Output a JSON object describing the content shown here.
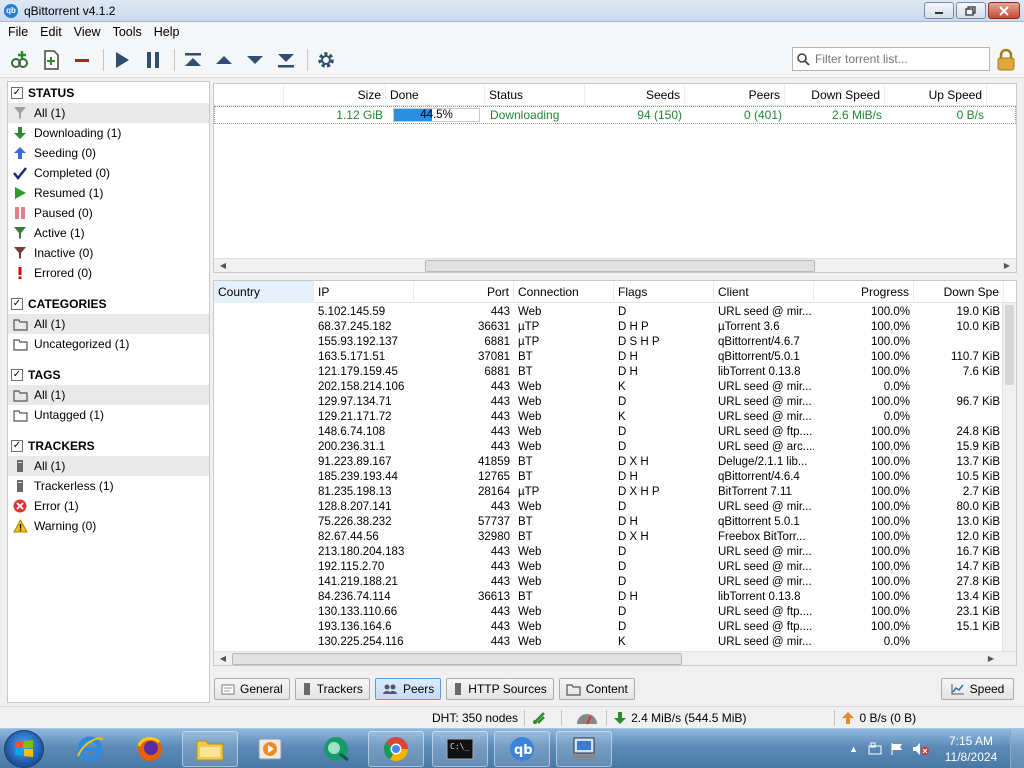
{
  "window": {
    "title": "qBittorrent v4.1.2",
    "app_icon": "qb"
  },
  "menu": [
    "File",
    "Edit",
    "View",
    "Tools",
    "Help"
  ],
  "toolbar": {
    "filter_placeholder": "Filter torrent list..."
  },
  "sidebar": {
    "status": {
      "title": "STATUS",
      "items": [
        {
          "label": "All (1)",
          "icon": "filter-icon",
          "color": "#a0a0a0"
        },
        {
          "label": "Downloading (1)",
          "icon": "arrow-down-icon",
          "color": "#2e8b2e"
        },
        {
          "label": "Seeding (0)",
          "icon": "arrow-up-icon",
          "color": "#3b6fd6"
        },
        {
          "label": "Completed (0)",
          "icon": "checkmark-icon",
          "color": "#1d2b7a"
        },
        {
          "label": "Resumed (1)",
          "icon": "play-icon",
          "color": "#2e9b2e"
        },
        {
          "label": "Paused (0)",
          "icon": "pause-icon",
          "color": "#e08080"
        },
        {
          "label": "Active (1)",
          "icon": "filter-icon",
          "color": "#3a7a3a"
        },
        {
          "label": "Inactive (0)",
          "icon": "filter-icon",
          "color": "#7a3a3a"
        },
        {
          "label": "Errored (0)",
          "icon": "exclamation-icon",
          "color": "#e00000"
        }
      ]
    },
    "categories": {
      "title": "CATEGORIES",
      "items": [
        "All (1)",
        "Uncategorized (1)"
      ]
    },
    "tags": {
      "title": "TAGS",
      "items": [
        "All (1)",
        "Untagged (1)"
      ]
    },
    "trackers": {
      "title": "TRACKERS",
      "items": [
        {
          "label": "All (1)",
          "icon": "server-icon"
        },
        {
          "label": "Trackerless (1)",
          "icon": "server-icon"
        },
        {
          "label": "Error (1)",
          "icon": "error-icon"
        },
        {
          "label": "Warning (0)",
          "icon": "warning-icon"
        }
      ]
    }
  },
  "torrent_list": {
    "columns": [
      "Size",
      "Done",
      "Status",
      "Seeds",
      "Peers",
      "Down Speed",
      "Up Speed"
    ],
    "rows": [
      {
        "size": "1.12 GiB",
        "done": "44.5%",
        "done_fraction": 0.445,
        "status": "Downloading",
        "seeds": "94 (150)",
        "peers": "0 (401)",
        "down_speed": "2.6 MiB/s",
        "up_speed": "0 B/s"
      }
    ]
  },
  "peers": {
    "columns": [
      "Country",
      "IP",
      "Port",
      "Connection",
      "Flags",
      "Client",
      "Progress",
      "Down Spe"
    ],
    "rows": [
      [
        "",
        "5.102.145.59",
        "443",
        "Web",
        "D",
        "URL seed @ mir...",
        "100.0%",
        "19.0 KiB"
      ],
      [
        "",
        "68.37.245.182",
        "36631",
        "µTP",
        "D H P",
        "µTorrent 3.6",
        "100.0%",
        "10.0 KiB"
      ],
      [
        "",
        "155.93.192.137",
        "6881",
        "µTP",
        "D S H P",
        "qBittorrent/4.6.7",
        "100.0%",
        ""
      ],
      [
        "",
        "163.5.171.51",
        "37081",
        "BT",
        "D H",
        "qBittorrent/5.0.1",
        "100.0%",
        "110.7 KiB"
      ],
      [
        "",
        "121.179.159.45",
        "6881",
        "BT",
        "D H",
        "libTorrent 0.13.8",
        "100.0%",
        "7.6 KiB"
      ],
      [
        "",
        "202.158.214.106",
        "443",
        "Web",
        "K",
        "URL seed @ mir...",
        "0.0%",
        ""
      ],
      [
        "",
        "129.97.134.71",
        "443",
        "Web",
        "D",
        "URL seed @ mir...",
        "100.0%",
        "96.7 KiB"
      ],
      [
        "",
        "129.21.171.72",
        "443",
        "Web",
        "K",
        "URL seed @ mir...",
        "0.0%",
        ""
      ],
      [
        "",
        "148.6.74.108",
        "443",
        "Web",
        "D",
        "URL seed @ ftp....",
        "100.0%",
        "24.8 KiB"
      ],
      [
        "",
        "200.236.31.1",
        "443",
        "Web",
        "D",
        "URL seed @ arc....",
        "100.0%",
        "15.9 KiB"
      ],
      [
        "",
        "91.223.89.167",
        "41859",
        "BT",
        "D X H",
        "Deluge/2.1.1 lib...",
        "100.0%",
        "13.7 KiB"
      ],
      [
        "",
        "185.239.193.44",
        "12765",
        "BT",
        "D H",
        "qBittorrent/4.6.4",
        "100.0%",
        "10.5 KiB"
      ],
      [
        "",
        "81.235.198.13",
        "28164",
        "µTP",
        "D X H P",
        "BitTorrent 7.11",
        "100.0%",
        "2.7 KiB"
      ],
      [
        "",
        "128.8.207.141",
        "443",
        "Web",
        "D",
        "URL seed @ mir...",
        "100.0%",
        "80.0 KiB"
      ],
      [
        "",
        "75.226.38.232",
        "57737",
        "BT",
        "D H",
        "qBittorrent 5.0.1",
        "100.0%",
        "13.0 KiB"
      ],
      [
        "",
        "82.67.44.56",
        "32980",
        "BT",
        "D X H",
        "Freebox BitTorr...",
        "100.0%",
        "12.0 KiB"
      ],
      [
        "",
        "213.180.204.183",
        "443",
        "Web",
        "D",
        "URL seed @ mir...",
        "100.0%",
        "16.7 KiB"
      ],
      [
        "",
        "192.115.2.70",
        "443",
        "Web",
        "D",
        "URL seed @ mir...",
        "100.0%",
        "14.7 KiB"
      ],
      [
        "",
        "141.219.188.21",
        "443",
        "Web",
        "D",
        "URL seed @ mir...",
        "100.0%",
        "27.8 KiB"
      ],
      [
        "",
        "84.236.74.114",
        "36613",
        "BT",
        "D H",
        "libTorrent 0.13.8",
        "100.0%",
        "13.4 KiB"
      ],
      [
        "",
        "130.133.110.66",
        "443",
        "Web",
        "D",
        "URL seed @ ftp....",
        "100.0%",
        "23.1 KiB"
      ],
      [
        "",
        "193.136.164.6",
        "443",
        "Web",
        "D",
        "URL seed @ ftp....",
        "100.0%",
        "15.1 KiB"
      ],
      [
        "",
        "130.225.254.116",
        "443",
        "Web",
        "K",
        "URL seed @ mir...",
        "0.0%",
        ""
      ]
    ]
  },
  "tabs": [
    "General",
    "Trackers",
    "Peers",
    "HTTP Sources",
    "Content"
  ],
  "active_tab": "Peers",
  "speed_button": "Speed",
  "statusbar": {
    "dht": "DHT: 350 nodes",
    "download": "2.4 MiB/s (544.5 MiB)",
    "upload": "0 B/s (0 B)"
  },
  "taskbar": {
    "time": "7:15 AM",
    "date": "11/8/2024"
  },
  "colors": {
    "accent": "#2d8fe0",
    "downloading_text": "#1f8a2e"
  }
}
